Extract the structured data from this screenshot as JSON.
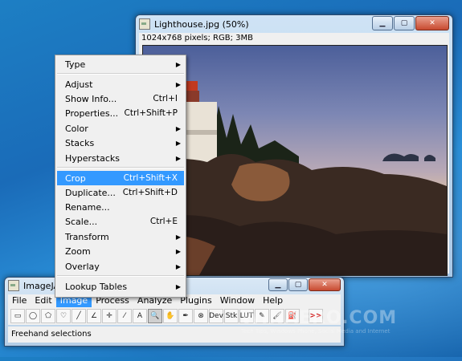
{
  "photo_window": {
    "title": "Lighthouse.jpg (50%)",
    "info": "1024x768 pixels; RGB; 3MB",
    "buttons": {
      "minimize": "▁",
      "maximize": "▢",
      "close": "✕"
    }
  },
  "context_menu": {
    "items": [
      {
        "label": "Type",
        "shortcut": "",
        "submenu": true
      },
      {
        "label": "Adjust",
        "shortcut": "",
        "submenu": true
      },
      {
        "label": "Show Info...",
        "shortcut": "Ctrl+I",
        "submenu": false
      },
      {
        "label": "Properties...",
        "shortcut": "Ctrl+Shift+P",
        "submenu": false
      },
      {
        "label": "Color",
        "shortcut": "",
        "submenu": true
      },
      {
        "label": "Stacks",
        "shortcut": "",
        "submenu": true
      },
      {
        "label": "Hyperstacks",
        "shortcut": "",
        "submenu": true
      },
      {
        "label": "Crop",
        "shortcut": "Ctrl+Shift+X",
        "submenu": false
      },
      {
        "label": "Duplicate...",
        "shortcut": "Ctrl+Shift+D",
        "submenu": false
      },
      {
        "label": "Rename...",
        "shortcut": "",
        "submenu": false
      },
      {
        "label": "Scale...",
        "shortcut": "Ctrl+E",
        "submenu": false
      },
      {
        "label": "Transform",
        "shortcut": "",
        "submenu": true
      },
      {
        "label": "Zoom",
        "shortcut": "",
        "submenu": true
      },
      {
        "label": "Overlay",
        "shortcut": "",
        "submenu": true
      },
      {
        "label": "Lookup Tables",
        "shortcut": "",
        "submenu": true
      }
    ],
    "selected": "Crop",
    "arrow_glyph": "▶"
  },
  "imageja_window": {
    "title": "ImageJA",
    "menubar": [
      "File",
      "Edit",
      "Image",
      "Process",
      "Analyze",
      "Plugins",
      "Window",
      "Help"
    ],
    "active_menu": "Image",
    "tools": [
      {
        "name": "rectangle-tool-icon",
        "glyph": "▭"
      },
      {
        "name": "oval-tool-icon",
        "glyph": "◯"
      },
      {
        "name": "polygon-tool-icon",
        "glyph": "⬠"
      },
      {
        "name": "freehand-tool-icon",
        "glyph": "♡"
      },
      {
        "name": "line-tool-icon",
        "glyph": "╱"
      },
      {
        "name": "angle-tool-icon",
        "glyph": "∠"
      },
      {
        "name": "point-tool-icon",
        "glyph": "✛"
      },
      {
        "name": "wand-tool-icon",
        "glyph": "⁄"
      },
      {
        "name": "text-tool-icon",
        "glyph": "A"
      },
      {
        "name": "magnifier-tool-icon",
        "glyph": "🔍"
      },
      {
        "name": "hand-tool-icon",
        "glyph": "✋"
      },
      {
        "name": "dropper-tool-icon",
        "glyph": "✒"
      },
      {
        "name": "stop-tool-icon",
        "glyph": "⊗"
      },
      {
        "name": "dev-tool-icon",
        "glyph": "Dev"
      },
      {
        "name": "stk-tool-icon",
        "glyph": "Stk"
      },
      {
        "name": "lut-tool-icon",
        "glyph": "LUT"
      },
      {
        "name": "pencil-tool-icon",
        "glyph": "✎"
      },
      {
        "name": "brush-tool-icon",
        "glyph": "🖌"
      },
      {
        "name": "flood-fill-tool-icon",
        "glyph": "⛽"
      },
      {
        "name": "more-tools-icon",
        "glyph": ">>"
      }
    ],
    "pressed_tool": "magnifier-tool-icon",
    "status": "Freehand selections"
  },
  "watermark": {
    "logo": "WINAERO.COM",
    "sub": "Tech Tips, Windows Phone, Social Media and Internet"
  },
  "colors": {
    "selection": "#3399ff",
    "desktop": "#1a6bb8"
  }
}
